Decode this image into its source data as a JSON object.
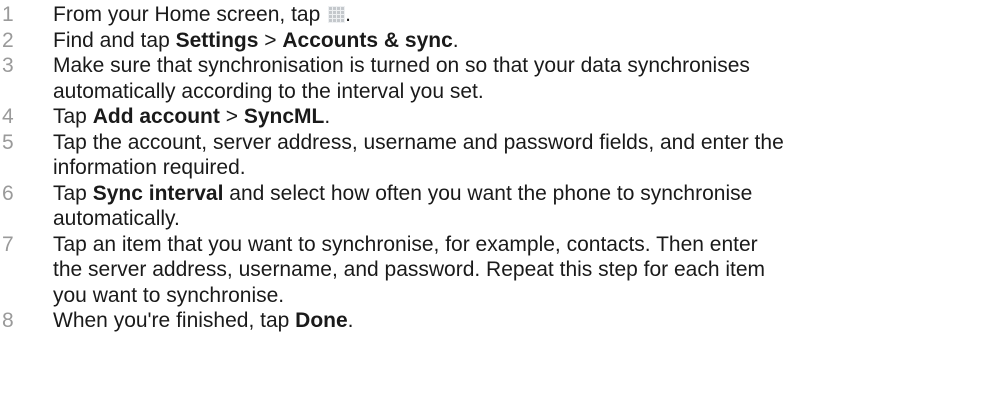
{
  "steps": [
    {
      "number": "1",
      "before": "From your Home screen, tap ",
      "icon": "apps-grid-icon",
      "after": "."
    },
    {
      "number": "2",
      "text1": "Find and tap ",
      "bold1": "Settings",
      "text2": " > ",
      "bold2": "Accounts & sync",
      "text3": "."
    },
    {
      "number": "3",
      "line1": "Make sure that synchronisation is turned on so that your data synchronises",
      "line2": "automatically according to the interval you set."
    },
    {
      "number": "4",
      "text1": "Tap ",
      "bold1": "Add account",
      "text2": " > ",
      "bold2": "SyncML",
      "text3": "."
    },
    {
      "number": "5",
      "line1": "Tap the account, server address, username and password fields, and enter the",
      "line2": "information required."
    },
    {
      "number": "6",
      "text1": "Tap ",
      "bold1": "Sync interval",
      "text2": " and select how often you want the phone to synchronise",
      "line2": "automatically."
    },
    {
      "number": "7",
      "line1": "Tap an item that you want to synchronise, for example, contacts. Then enter",
      "line2": "the server address, username, and password. Repeat this step for each item",
      "line3": "you want to synchronise."
    },
    {
      "number": "8",
      "text1": "When you're finished, tap ",
      "bold1": "Done",
      "text2": "."
    }
  ]
}
